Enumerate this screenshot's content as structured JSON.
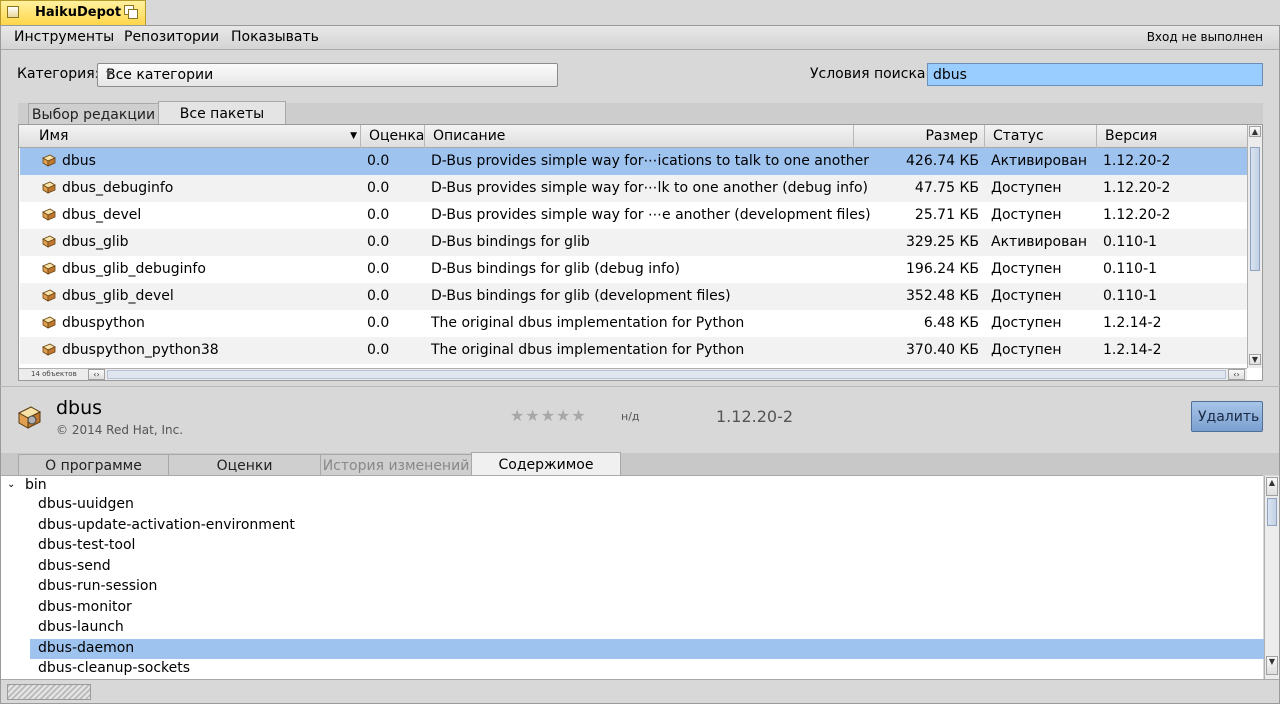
{
  "window": {
    "title": "HaikuDepot"
  },
  "menubar": {
    "items": [
      "Инструменты",
      "Репозитории",
      "Показывать"
    ],
    "login_status": "Вход не выполнен"
  },
  "filters": {
    "category_label": "Категория:",
    "category_value": "Все категории",
    "search_label": "Условия поиска:",
    "search_value": "dbus"
  },
  "top_tabs": [
    "Выбор редакции",
    "Все пакеты"
  ],
  "columns": {
    "name": "Имя",
    "rating": "Оценка",
    "description": "Описание",
    "size": "Размер",
    "status": "Статус",
    "version": "Версия"
  },
  "packages": [
    {
      "name": "dbus",
      "rating": "0.0",
      "description": "D-Bus provides simple way for⋯ications to talk to one another",
      "size": "426.74 КБ",
      "status": "Активирован",
      "version": "1.12.20-2"
    },
    {
      "name": "dbus_debuginfo",
      "rating": "0.0",
      "description": "D-Bus provides simple way for⋯lk to one another (debug info)",
      "size": "47.75 КБ",
      "status": "Доступен",
      "version": "1.12.20-2"
    },
    {
      "name": "dbus_devel",
      "rating": "0.0",
      "description": "D-Bus provides simple way for ⋯e another (development files)",
      "size": "25.71 КБ",
      "status": "Доступен",
      "version": "1.12.20-2"
    },
    {
      "name": "dbus_glib",
      "rating": "0.0",
      "description": "D-Bus bindings for glib",
      "size": "329.25 КБ",
      "status": "Активирован",
      "version": "0.110-1"
    },
    {
      "name": "dbus_glib_debuginfo",
      "rating": "0.0",
      "description": "D-Bus bindings for glib (debug info)",
      "size": "196.24 КБ",
      "status": "Доступен",
      "version": "0.110-1"
    },
    {
      "name": "dbus_glib_devel",
      "rating": "0.0",
      "description": "D-Bus bindings for glib (development files)",
      "size": "352.48 КБ",
      "status": "Доступен",
      "version": "0.110-1"
    },
    {
      "name": "dbuspython",
      "rating": "0.0",
      "description": "The original dbus implementation for Python",
      "size": "6.48 КБ",
      "status": "Доступен",
      "version": "1.2.14-2"
    },
    {
      "name": "dbuspython_python38",
      "rating": "0.0",
      "description": "The original dbus implementation for Python",
      "size": "370.40 КБ",
      "status": "Доступен",
      "version": "1.2.14-2"
    }
  ],
  "list_footer": {
    "count": "14 объектов"
  },
  "details": {
    "name": "dbus",
    "copyright": "© 2014 Red Hat, Inc.",
    "stars": "★★★★★",
    "rating": "н/д",
    "version": "1.12.20-2",
    "action_button": "Удалить"
  },
  "bottom_tabs": [
    "О программе",
    "Оценки",
    "История изменений",
    "Содержимое"
  ],
  "contents": {
    "folder": "bin",
    "files": [
      "dbus-uuidgen",
      "dbus-update-activation-environment",
      "dbus-test-tool",
      "dbus-send",
      "dbus-run-session",
      "dbus-monitor",
      "dbus-launch",
      "dbus-daemon",
      "dbus-cleanup-sockets"
    ]
  }
}
